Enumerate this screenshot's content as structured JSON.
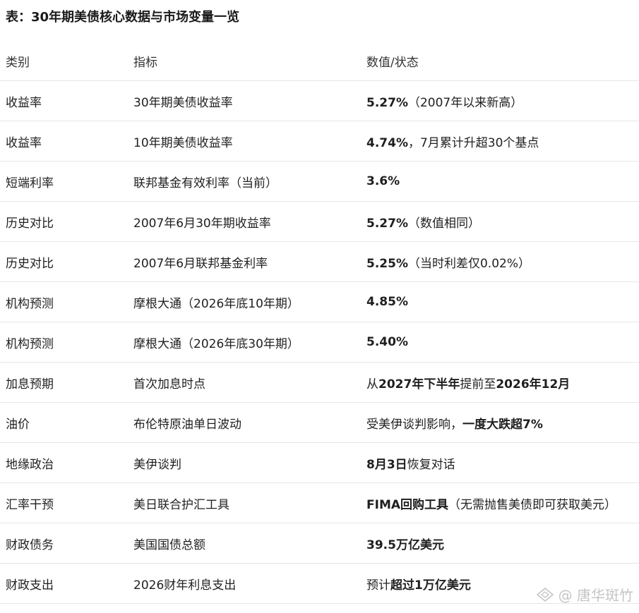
{
  "title": "表：30年期美债核心数据与市场变量一览",
  "table": {
    "headers": [
      "类别",
      "指标",
      "数值/状态"
    ],
    "rows": [
      {
        "category": "收益率",
        "metric": "30年期美债收益率",
        "value": [
          {
            "t": "5.27%",
            "b": true
          },
          {
            "t": "（2007年以来新高）",
            "b": false
          }
        ]
      },
      {
        "category": "收益率",
        "metric": "10年期美债收益率",
        "value": [
          {
            "t": "4.74%",
            "b": true
          },
          {
            "t": "，7月累计升超30个基点",
            "b": false
          }
        ]
      },
      {
        "category": "短端利率",
        "metric": "联邦基金有效利率（当前）",
        "value": [
          {
            "t": "3.6%",
            "b": true
          }
        ]
      },
      {
        "category": "历史对比",
        "metric": "2007年6月30年期收益率",
        "value": [
          {
            "t": "5.27%",
            "b": true
          },
          {
            "t": "（数值相同）",
            "b": false
          }
        ]
      },
      {
        "category": "历史对比",
        "metric": "2007年6月联邦基金利率",
        "value": [
          {
            "t": "5.25%",
            "b": true
          },
          {
            "t": "（当时利差仅0.02%）",
            "b": false
          }
        ]
      },
      {
        "category": "机构预测",
        "metric": "摩根大通（2026年底10年期）",
        "value": [
          {
            "t": "4.85%",
            "b": true
          }
        ]
      },
      {
        "category": "机构预测",
        "metric": "摩根大通（2026年底30年期）",
        "value": [
          {
            "t": "5.40%",
            "b": true
          }
        ]
      },
      {
        "category": "加息预期",
        "metric": "首次加息时点",
        "value": [
          {
            "t": "从",
            "b": false
          },
          {
            "t": "2027年下半年",
            "b": true
          },
          {
            "t": "提前至",
            "b": false
          },
          {
            "t": "2026年12月",
            "b": true
          }
        ]
      },
      {
        "category": "油价",
        "metric": "布伦特原油单日波动",
        "value": [
          {
            "t": "受美伊谈判影响，",
            "b": false
          },
          {
            "t": "一度大跌超7%",
            "b": true
          }
        ]
      },
      {
        "category": "地缘政治",
        "metric": "美伊谈判",
        "value": [
          {
            "t": "8月3日",
            "b": true
          },
          {
            "t": "恢复对话",
            "b": false
          }
        ]
      },
      {
        "category": "汇率干预",
        "metric": "美日联合护汇工具",
        "value": [
          {
            "t": "FIMA回购工具",
            "b": true
          },
          {
            "t": "（无需抛售美债即可获取美元）",
            "b": false
          }
        ]
      },
      {
        "category": "财政债务",
        "metric": "美国国债总额",
        "value": [
          {
            "t": "39.5万亿美元",
            "b": true
          }
        ]
      },
      {
        "category": "财政支出",
        "metric": "2026财年利息支出",
        "value": [
          {
            "t": "预计",
            "b": false
          },
          {
            "t": "超过1万亿美元",
            "b": true
          }
        ]
      }
    ]
  },
  "watermark": {
    "text": "@ 唐华斑竹",
    "icon": "brand-logo-icon",
    "color": "#c4c4c4"
  }
}
